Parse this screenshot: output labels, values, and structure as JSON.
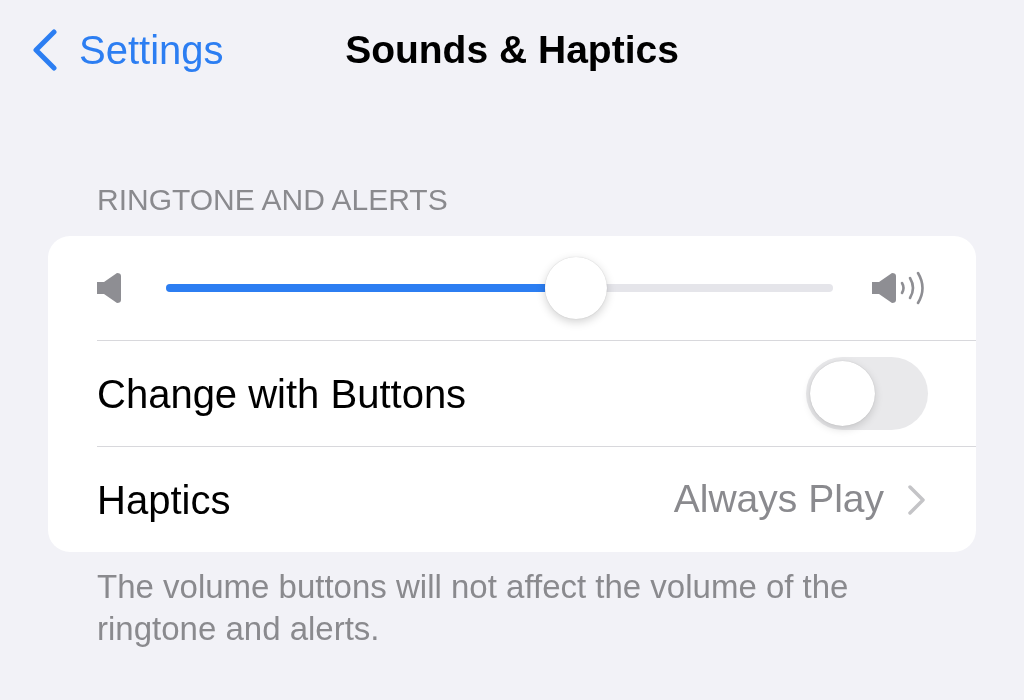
{
  "nav": {
    "back_label": "Settings",
    "title": "Sounds & Haptics"
  },
  "section": {
    "header": "RINGTONE AND ALERTS",
    "rows": [
      {
        "kind": "slider",
        "level": 0.615
      },
      {
        "kind": "toggle",
        "label": "Change with Buttons",
        "on": false
      },
      {
        "kind": "link",
        "label": "Haptics",
        "value": "Always Play"
      }
    ],
    "footer": "The volume buttons will not affect the volume of the ringtone and alerts."
  }
}
